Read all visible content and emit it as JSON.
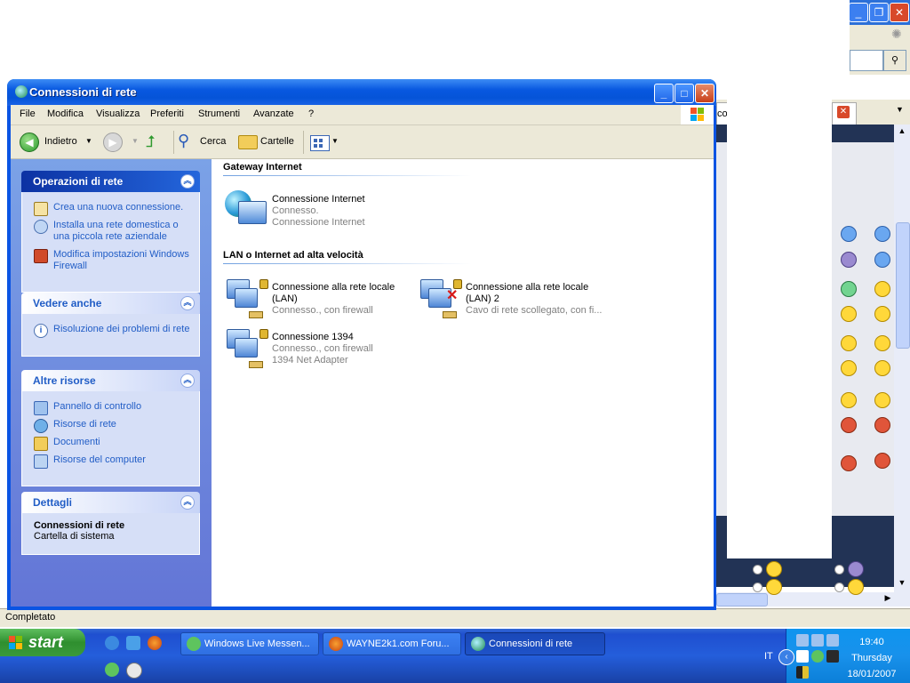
{
  "window": {
    "title": "Connessioni di rete",
    "controls": {
      "minimize": "_",
      "maximize": "□",
      "close": "✕"
    }
  },
  "menu": [
    "File",
    "Modifica",
    "Visualizza",
    "Preferiti",
    "Strumenti",
    "Avanzate",
    "?"
  ],
  "toolbar": {
    "back": "Indietro",
    "search": "Cerca",
    "folders": "Cartelle"
  },
  "sidebar": {
    "network_tasks": {
      "title": "Operazioni di rete",
      "items": [
        "Crea una nuova connessione.",
        "Installa una rete domestica o una piccola rete aziendale",
        "Modifica impostazioni Windows Firewall"
      ]
    },
    "see_also": {
      "title": "Vedere anche",
      "items": [
        "Risoluzione dei problemi di rete"
      ]
    },
    "other_places": {
      "title": "Altre risorse",
      "items": [
        "Pannello di controllo",
        "Risorse di rete",
        "Documenti",
        "Risorse del computer"
      ]
    },
    "details": {
      "title": "Dettagli",
      "name": "Connessioni di rete",
      "type": "Cartella di sistema"
    }
  },
  "groups": {
    "gateway": {
      "title": "Gateway Internet",
      "items": [
        {
          "name": "Connessione Internet",
          "status": "Connesso.",
          "device": "Connessione Internet"
        }
      ]
    },
    "lan": {
      "title": "LAN o Internet ad alta velocità",
      "items": [
        {
          "name_line1": "Connessione alla rete locale",
          "name_line2": "(LAN)",
          "status": "Connesso., con firewall"
        },
        {
          "name_line1": "Connessione alla rete locale",
          "name_line2": "(LAN) 2",
          "status": "Cavo di rete scollegato, con fi..."
        },
        {
          "name": "Connessione 1394",
          "status": "Connesso., con firewall",
          "device": "1394 Net Adapter"
        }
      ]
    }
  },
  "statusbar": "Completato",
  "background": {
    "tab_partial": "co"
  },
  "taskbar": {
    "start": "start",
    "tasks": [
      "Windows Live Messen...",
      "WAYNE2k1.com Foru...",
      "Connessioni di rete"
    ],
    "lang": "IT",
    "time": "19:40",
    "day": "Thursday",
    "date": "18/01/2007"
  },
  "colors": {
    "xp_blue": "#0a54e3",
    "task_link": "#215dc6",
    "taskbar": "#245edb",
    "start_green": "#3a9a3a"
  }
}
